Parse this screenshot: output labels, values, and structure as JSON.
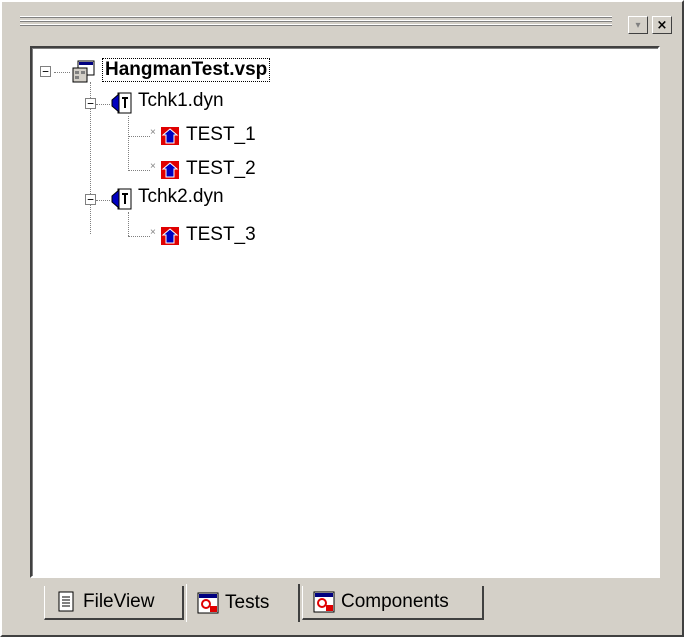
{
  "window": {
    "close_label": "×",
    "menu_label": "▾"
  },
  "tree": {
    "root": {
      "label": "HangmanTest.vsp",
      "expanded": true
    },
    "groups": [
      {
        "label": "Tchk1.dyn",
        "expanded": true,
        "tests": [
          "TEST_1",
          "TEST_2"
        ]
      },
      {
        "label": "Tchk2.dyn",
        "expanded": true,
        "tests": [
          "TEST_3"
        ]
      }
    ]
  },
  "tabs": [
    {
      "label": "FileView",
      "icon": "document-icon",
      "active": false
    },
    {
      "label": "Tests",
      "icon": "tests-icon",
      "active": true
    },
    {
      "label": "Components",
      "icon": "components-icon",
      "active": false
    }
  ],
  "colors": {
    "face": "#d4d0c8",
    "shadow": "#808080",
    "dark": "#404040",
    "test_red": "#e00000",
    "test_blue": "#0000c0"
  }
}
